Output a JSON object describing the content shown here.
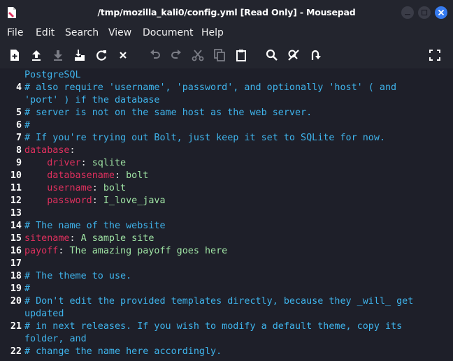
{
  "window": {
    "title": "/tmp/mozilla_kali0/config.yml [Read Only] - Mousepad"
  },
  "colors": {
    "background": "#1e1f29",
    "comment": "#3fb4ec",
    "key": "#e0305e",
    "value": "#9fe3a4",
    "close_button": "#367bf0"
  },
  "menu": {
    "file": "File",
    "edit": "Edit",
    "search": "Search",
    "view": "View",
    "document": "Document",
    "help": "Help"
  },
  "toolbar": {
    "icons": [
      "new-document-icon",
      "upload-icon",
      "download-icon",
      "save-as-icon",
      "reload-icon",
      "close-icon",
      "undo-icon",
      "redo-icon",
      "cut-icon",
      "copy-icon",
      "paste-icon",
      "search-icon",
      "replace-icon",
      "goto-icon",
      "fullscreen-icon"
    ]
  },
  "editor": {
    "lines": [
      {
        "num": "",
        "parts": [
          {
            "t": "PostgreSQL",
            "c": "comment"
          }
        ]
      },
      {
        "num": "4",
        "parts": [
          {
            "t": "# also require 'username', 'password', and optionally 'host' ( and",
            "c": "comment"
          }
        ]
      },
      {
        "num": "",
        "parts": [
          {
            "t": "'port' ) if the database",
            "c": "comment"
          }
        ]
      },
      {
        "num": "5",
        "parts": [
          {
            "t": "# server is not on the same host as the web server.",
            "c": "comment"
          }
        ]
      },
      {
        "num": "6",
        "parts": [
          {
            "t": "#",
            "c": "comment"
          }
        ]
      },
      {
        "num": "7",
        "parts": [
          {
            "t": "# If you're trying out Bolt, just keep it set to SQLite for now.",
            "c": "comment"
          }
        ]
      },
      {
        "num": "8",
        "parts": [
          {
            "t": "database",
            "c": "key"
          },
          {
            "t": ":",
            "c": "punc"
          }
        ]
      },
      {
        "num": "9",
        "parts": [
          {
            "t": "    ",
            "c": "plain"
          },
          {
            "t": "driver",
            "c": "key"
          },
          {
            "t": ": ",
            "c": "punc"
          },
          {
            "t": "sqlite",
            "c": "val"
          }
        ]
      },
      {
        "num": "10",
        "parts": [
          {
            "t": "    ",
            "c": "plain"
          },
          {
            "t": "databasename",
            "c": "key"
          },
          {
            "t": ": ",
            "c": "punc"
          },
          {
            "t": "bolt",
            "c": "val"
          }
        ]
      },
      {
        "num": "11",
        "parts": [
          {
            "t": "    ",
            "c": "plain"
          },
          {
            "t": "username",
            "c": "key"
          },
          {
            "t": ": ",
            "c": "punc"
          },
          {
            "t": "bolt",
            "c": "val"
          }
        ]
      },
      {
        "num": "12",
        "parts": [
          {
            "t": "    ",
            "c": "plain"
          },
          {
            "t": "password",
            "c": "key"
          },
          {
            "t": ": ",
            "c": "punc"
          },
          {
            "t": "I_love_java",
            "c": "val"
          }
        ]
      },
      {
        "num": "13",
        "parts": []
      },
      {
        "num": "14",
        "parts": [
          {
            "t": "# The name of the website",
            "c": "comment"
          }
        ]
      },
      {
        "num": "15",
        "parts": [
          {
            "t": "sitename",
            "c": "key"
          },
          {
            "t": ": ",
            "c": "punc"
          },
          {
            "t": "A sample site",
            "c": "val"
          }
        ]
      },
      {
        "num": "16",
        "parts": [
          {
            "t": "payoff",
            "c": "key"
          },
          {
            "t": ": ",
            "c": "punc"
          },
          {
            "t": "The amazing payoff goes here",
            "c": "val"
          }
        ]
      },
      {
        "num": "17",
        "parts": []
      },
      {
        "num": "18",
        "parts": [
          {
            "t": "# The theme to use.",
            "c": "comment"
          }
        ]
      },
      {
        "num": "19",
        "parts": [
          {
            "t": "#",
            "c": "comment"
          }
        ]
      },
      {
        "num": "20",
        "parts": [
          {
            "t": "# Don't edit the provided templates directly, because they _will_ get",
            "c": "comment"
          }
        ]
      },
      {
        "num": "",
        "parts": [
          {
            "t": "updated",
            "c": "comment"
          }
        ]
      },
      {
        "num": "21",
        "parts": [
          {
            "t": "# in next releases. If you wish to modify a default theme, copy its",
            "c": "comment"
          }
        ]
      },
      {
        "num": "",
        "parts": [
          {
            "t": "folder, and",
            "c": "comment"
          }
        ]
      },
      {
        "num": "22",
        "parts": [
          {
            "t": "# change the name here accordingly.",
            "c": "comment"
          }
        ]
      }
    ]
  }
}
